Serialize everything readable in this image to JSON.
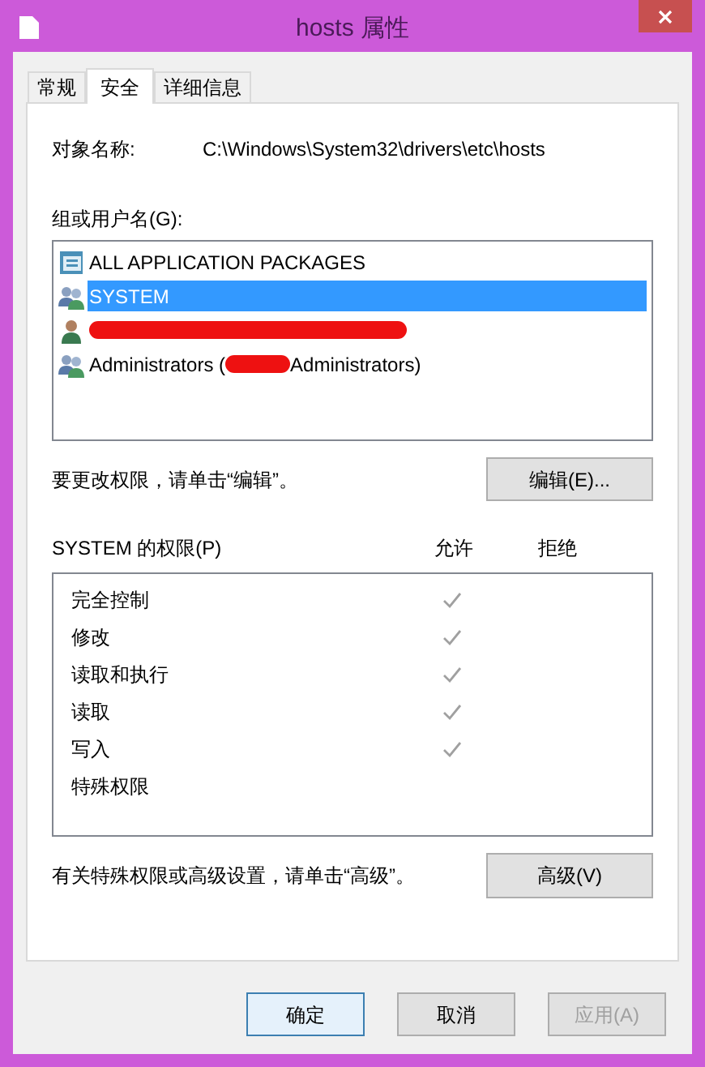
{
  "window": {
    "title": "hosts 属性"
  },
  "tabs": [
    {
      "label": "常规",
      "selected": false
    },
    {
      "label": "安全",
      "selected": true
    },
    {
      "label": "详细信息",
      "selected": false
    }
  ],
  "object_name": {
    "label": "对象名称:",
    "value": "C:\\Windows\\System32\\drivers\\etc\\hosts"
  },
  "users": {
    "label": "组或用户名(G):",
    "items": [
      {
        "kind": "packages",
        "name": "ALL APPLICATION PACKAGES",
        "selected": false
      },
      {
        "kind": "group",
        "name": "SYSTEM",
        "selected": true
      },
      {
        "kind": "user_redacted",
        "selected": false
      },
      {
        "kind": "group_partly_redacted",
        "before": "Administrators (",
        "after": "Administrators)",
        "selected": false
      }
    ]
  },
  "edit_hint": "要更改权限，请单击“编辑”。",
  "edit_button": "编辑(E)...",
  "permissions": {
    "label": "SYSTEM 的权限(P)",
    "allow_header": "允许",
    "deny_header": "拒绝",
    "rows": [
      {
        "name": "完全控制",
        "allow": true,
        "deny": false
      },
      {
        "name": "修改",
        "allow": true,
        "deny": false
      },
      {
        "name": "读取和执行",
        "allow": true,
        "deny": false
      },
      {
        "name": "读取",
        "allow": true,
        "deny": false
      },
      {
        "name": "写入",
        "allow": true,
        "deny": false
      },
      {
        "name": "特殊权限",
        "allow": false,
        "deny": false
      }
    ]
  },
  "advanced_hint": "有关特殊权限或高级设置，请单击“高级”。",
  "advanced_button": "高级(V)",
  "buttons": [
    {
      "label": "确定",
      "disabled": false,
      "default": true
    },
    {
      "label": "取消",
      "disabled": false,
      "default": false
    },
    {
      "label": "应用(A)",
      "disabled": true,
      "default": false
    }
  ]
}
